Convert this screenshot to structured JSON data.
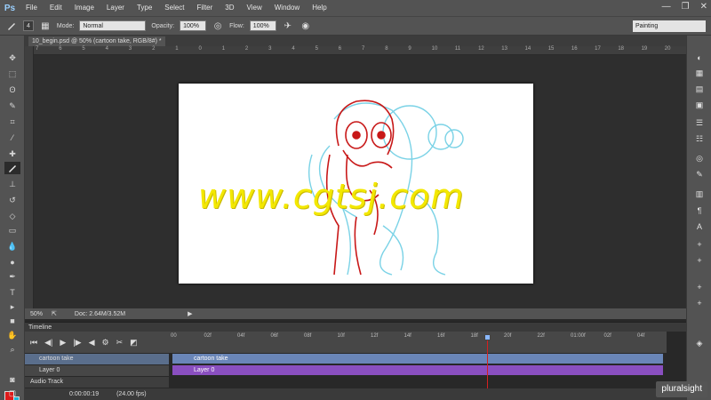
{
  "app": {
    "logo": "Ps",
    "menu": [
      "File",
      "Edit",
      "Image",
      "Layer",
      "Type",
      "Select",
      "Filter",
      "3D",
      "View",
      "Window",
      "Help"
    ],
    "window_controls": [
      "—",
      "❐",
      "✕"
    ]
  },
  "options": {
    "brush_size": "4",
    "mode_label": "Mode:",
    "mode_value": "Normal",
    "opacity_label": "Opacity:",
    "opacity_value": "100%",
    "flow_label": "Flow:",
    "flow_value": "100%",
    "workspace": "Painting"
  },
  "document": {
    "tab_title": "10_begin.psd @ 50% (cartoon take, RGB/8#) *",
    "ruler_ticks": [
      "7",
      "6",
      "5",
      "4",
      "3",
      "2",
      "1",
      "0",
      "1",
      "2",
      "3",
      "4",
      "5",
      "6",
      "7",
      "8",
      "9",
      "10",
      "11",
      "12",
      "13",
      "14",
      "15",
      "16",
      "17",
      "18",
      "19",
      "20"
    ],
    "watermark": "www.cgtsj.com"
  },
  "status": {
    "zoom": "50%",
    "doc_info": "Doc: 2.64M/3.52M"
  },
  "timeline": {
    "title": "Timeline",
    "ruler": [
      "00",
      "02f",
      "04f",
      "06f",
      "08f",
      "10f",
      "12f",
      "14f",
      "16f",
      "18f",
      "20f",
      "22f",
      "01:00f",
      "02f",
      "04f"
    ],
    "tracks": [
      {
        "name": "cartoon take",
        "bar_label": "cartoon take",
        "color": "#6a86b8"
      },
      {
        "name": "Layer 0",
        "bar_label": "Layer 0",
        "color": "#8a4fc0"
      },
      {
        "name": "Audio Track",
        "bar_label": "",
        "color": "#474747"
      }
    ],
    "timecode": "0:00:00:19",
    "fps": "(24.00 fps)"
  },
  "branding": "pluralsight",
  "colors": {
    "foreground": "#e01a1a",
    "background": "#19b7d8"
  }
}
